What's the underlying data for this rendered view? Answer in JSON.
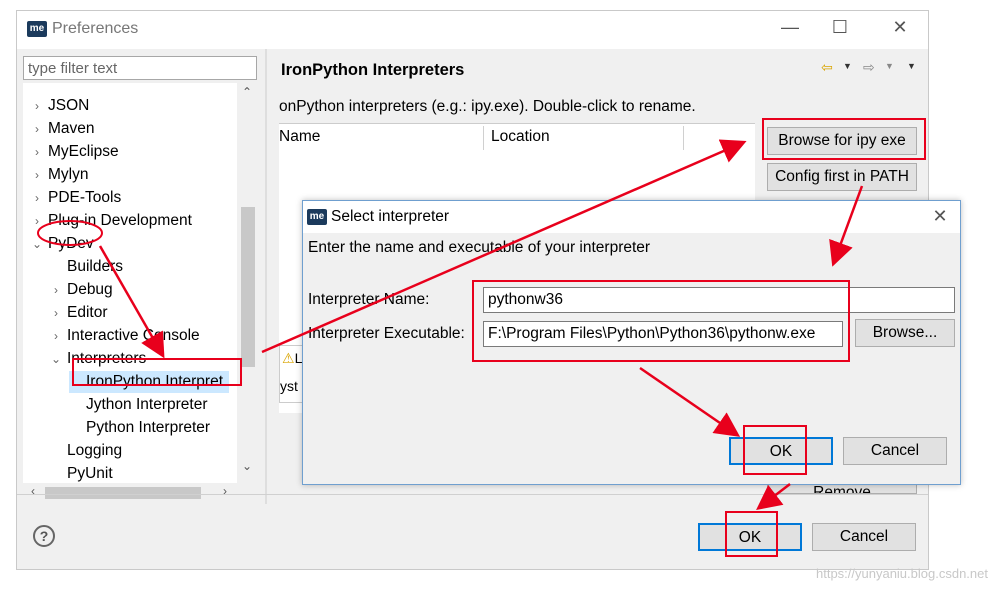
{
  "window": {
    "logo_text": "me",
    "title": "Preferences",
    "minimize_glyph": "—",
    "maximize_glyph": "☐",
    "close_glyph": "✕"
  },
  "filter": {
    "placeholder": "type filter text"
  },
  "tree": [
    {
      "label": "JSON",
      "twisty": "›"
    },
    {
      "label": "Maven",
      "twisty": "›"
    },
    {
      "label": "MyEclipse",
      "twisty": "›"
    },
    {
      "label": "Mylyn",
      "twisty": "›"
    },
    {
      "label": "PDE-Tools",
      "twisty": "›"
    },
    {
      "label": "Plug-in Development",
      "twisty": "›"
    },
    {
      "label": "PyDev",
      "twisty": "⌄"
    },
    {
      "label": "Builders",
      "twisty": ""
    },
    {
      "label": "Debug",
      "twisty": "›"
    },
    {
      "label": "Editor",
      "twisty": "›"
    },
    {
      "label": "Interactive Console",
      "twisty": "›"
    },
    {
      "label": "Interpreters",
      "twisty": "⌄"
    },
    {
      "label": "IronPython Interpret",
      "twisty": ""
    },
    {
      "label": "Jython Interpreter",
      "twisty": ""
    },
    {
      "label": "Python Interpreter",
      "twisty": ""
    },
    {
      "label": "Logging",
      "twisty": ""
    },
    {
      "label": "PyUnit",
      "twisty": ""
    }
  ],
  "scroll": {
    "up": "⌃",
    "down": "⌄",
    "left": "‹",
    "right": "›"
  },
  "page": {
    "title": "IronPython Interpreters",
    "nav_back": "⇦",
    "nav_forward": "⇨",
    "nav_menu": "▼",
    "description": "onPython interpreters (e.g.: ipy.exe).   Double-click to rename.",
    "col_name": "Name",
    "col_location": "Location",
    "browse_ipy_label": "Browse for ipy exe",
    "config_path_label": "Config first in PATH",
    "remove_label": "Remove",
    "partial_tab_li": "Li",
    "partial_tab_syst": "yst"
  },
  "footer": {
    "help_glyph": "?",
    "ok_label": "OK",
    "cancel_label": "Cancel"
  },
  "dialog": {
    "logo_text": "me",
    "title": "Select interpreter",
    "close_glyph": "✕",
    "instruction": "Enter the name and executable of your interpreter",
    "name_label": "Interpreter Name:",
    "name_value": "pythonw36",
    "exe_label": "Interpreter Executable:",
    "exe_value": "F:\\Program Files\\Python\\Python36\\pythonw.exe",
    "browse_label": "Browse...",
    "ok_label": "OK",
    "cancel_label": "Cancel"
  },
  "watermark": "https://yunyaniu.blog.csdn.net",
  "colors": {
    "annotation_red": "#e8001c",
    "focus_blue": "#0078d7",
    "selection": "#cce8ff"
  }
}
